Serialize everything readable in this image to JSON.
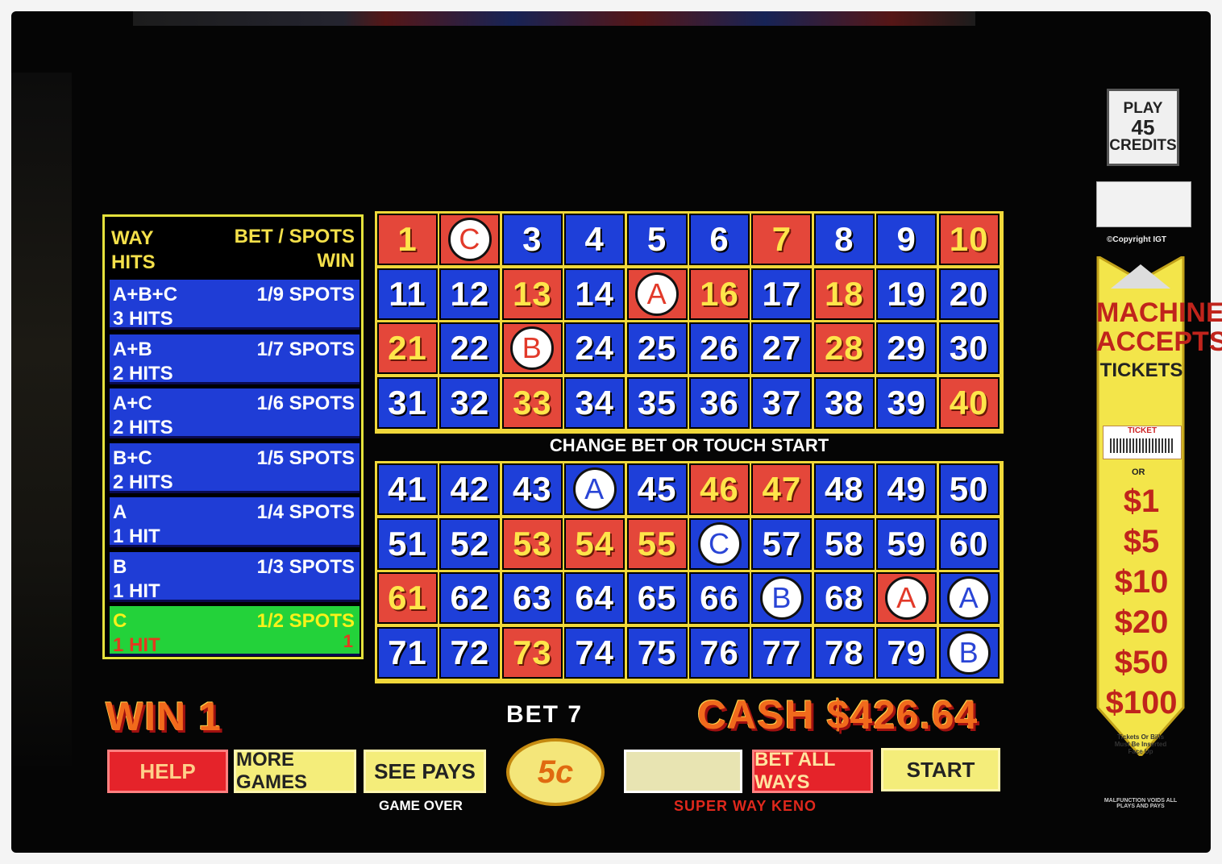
{
  "paytable": {
    "header_left_1": "WAY",
    "header_left_2": "HITS",
    "header_right_1": "BET / SPOTS",
    "header_right_2": "WIN",
    "rows": [
      {
        "way": "A+B+C",
        "hits": "3 HITS",
        "spots": "1/9 SPOTS"
      },
      {
        "way": "A+B",
        "hits": "2 HITS",
        "spots": "1/7 SPOTS"
      },
      {
        "way": "A+C",
        "hits": "2 HITS",
        "spots": "1/6 SPOTS"
      },
      {
        "way": "B+C",
        "hits": "2 HITS",
        "spots": "1/5 SPOTS"
      },
      {
        "way": "A",
        "hits": "1 HIT",
        "spots": "1/4 SPOTS"
      },
      {
        "way": "B",
        "hits": "1 HIT",
        "spots": "1/3 SPOTS"
      },
      {
        "way": "C",
        "hits": "1 HIT",
        "spots": "1/2 SPOTS",
        "win": "1",
        "active": true
      }
    ]
  },
  "board_top": {
    "drawn": [
      1,
      2,
      7,
      10,
      13,
      15,
      16,
      18,
      21,
      23,
      28,
      33,
      40
    ],
    "marks": {
      "2": "C",
      "15": "A",
      "23": "B"
    }
  },
  "board_bottom": {
    "drawn": [
      46,
      47,
      53,
      54,
      55,
      61,
      69,
      73
    ],
    "marks": {
      "44": "A",
      "56": "C",
      "67": "B",
      "69": "A",
      "70": "A",
      "80": "B"
    }
  },
  "status_message": "CHANGE BET OR TOUCH START",
  "win_label": "WIN 1",
  "bet_label": "BET 7",
  "cash_label": "CASH $426.64",
  "buttons": {
    "help": "HELP",
    "more_games": "MORE GAMES",
    "see_pays": "SEE PAYS",
    "denomination": "5c",
    "bet_all_ways": "BET ALL WAYS",
    "start": "START"
  },
  "game_over_label": "GAME OVER",
  "game_title": "SUPER WAY KENO",
  "machine": {
    "play_card": [
      "PLAY",
      "45",
      "CREDITS"
    ],
    "copyright": "©Copyright IGT",
    "accepts": [
      "MACHINE",
      "ACCEPTS"
    ],
    "tickets": "TICKETS",
    "ticket_label": "TICKET",
    "or": "OR",
    "amounts": [
      "$1",
      "$5",
      "$10",
      "$20",
      "$50",
      "$100"
    ],
    "note": "Tickets Or Bills Must Be Inserted Face Up",
    "malfunction": "MALFUNCTION VOIDS ALL PLAYS AND PAYS"
  },
  "colors": {
    "drawn": "#e4473a",
    "undrawn": "#1e3fd9",
    "frame": "#f0d83a",
    "win_text": "#f16a1c"
  }
}
